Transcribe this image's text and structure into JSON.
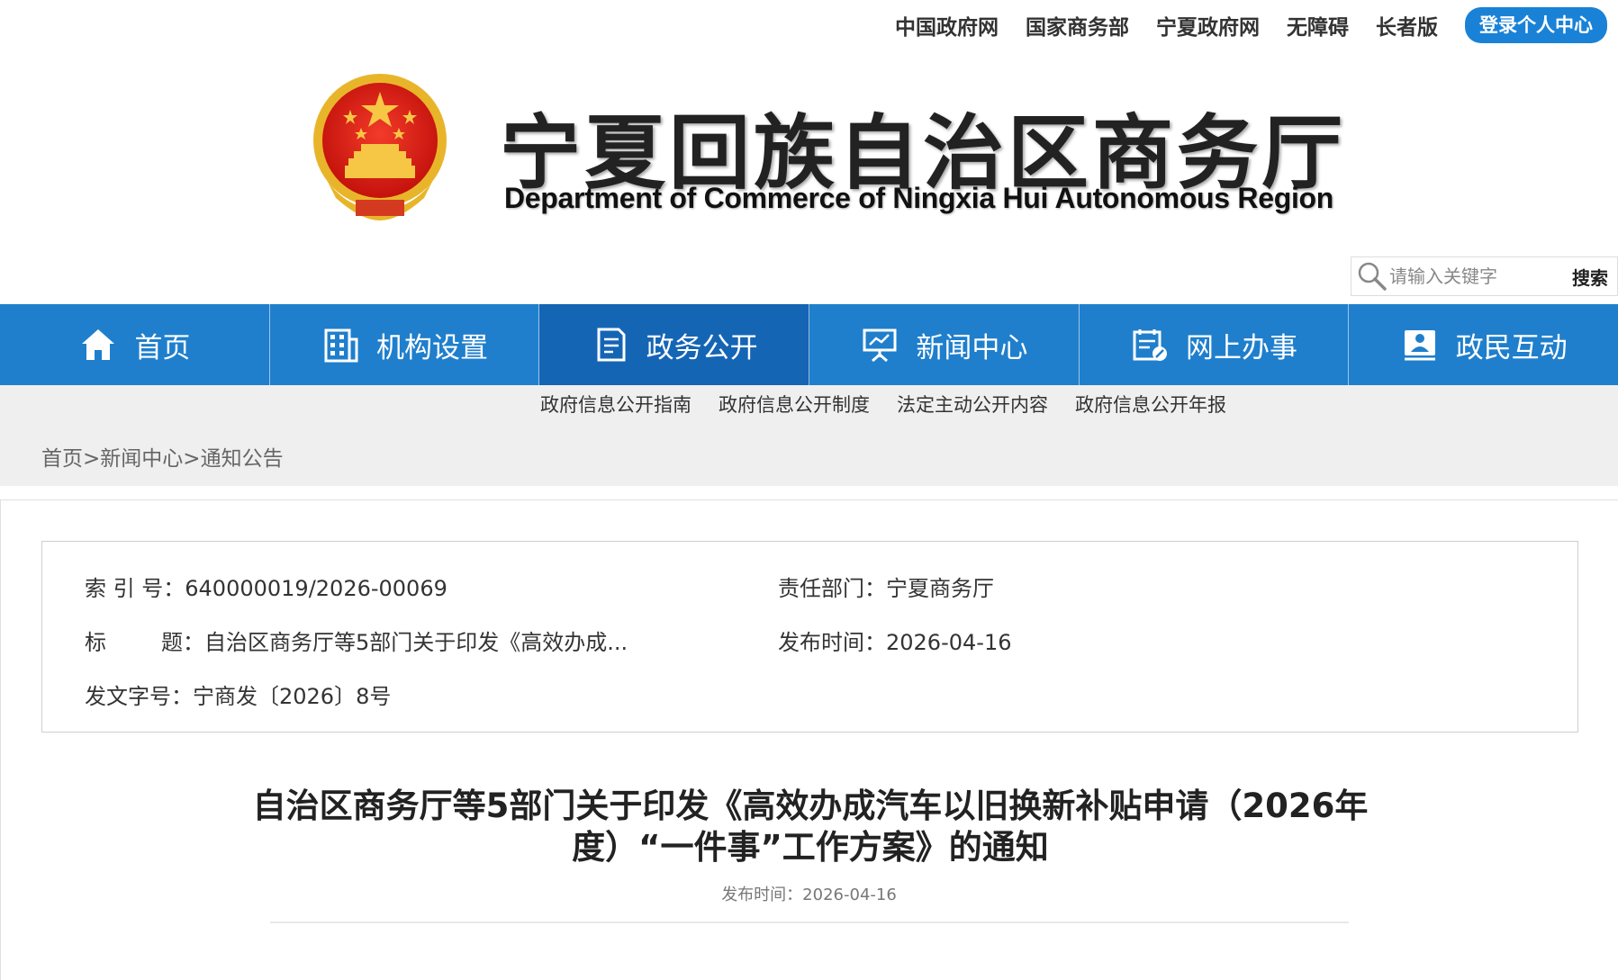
{
  "top_links": [
    "中国政府网",
    "国家商务部",
    "宁夏政府网",
    "无障碍",
    "长者版"
  ],
  "login_label": "登录个人中心",
  "header": {
    "title_cn": "宁夏回族自治区商务厅",
    "title_en": "Department of Commerce of Ningxia Hui Autonomous Region"
  },
  "search": {
    "placeholder": "请输入关键字",
    "button": "搜索"
  },
  "nav": [
    {
      "label": "首页",
      "icon": "home-icon"
    },
    {
      "label": "机构设置",
      "icon": "building-icon"
    },
    {
      "label": "政务公开",
      "icon": "document-icon",
      "active": true
    },
    {
      "label": "新闻中心",
      "icon": "presentation-icon"
    },
    {
      "label": "网上办事",
      "icon": "form-edit-icon"
    },
    {
      "label": "政民互动",
      "icon": "user-card-icon"
    }
  ],
  "subnav": [
    "政府信息公开指南",
    "政府信息公开制度",
    "法定主动公开内容",
    "政府信息公开年报"
  ],
  "breadcrumb": [
    "首页",
    "新闻中心",
    "通知公告"
  ],
  "meta": {
    "index_label": "索 引 号：",
    "index_value": "640000019/2026-00069",
    "dept_label": "责任部门：",
    "dept_value": "宁夏商务厅",
    "title_label": "标        题：",
    "title_value": "自治区商务厅等5部门关于印发《高效办成...",
    "date_label": "发布时间：",
    "date_value": "2026-04-16",
    "docno_label": "发文字号：",
    "docno_value": "宁商发〔2026〕8号"
  },
  "article": {
    "title": "自治区商务厅等5部门关于印发《高效办成汽车以旧换新补贴申请（2026年度）“一件事”工作方案》的通知",
    "pubtime": "发布时间：2026-04-16"
  },
  "colors": {
    "nav_blue": "#1f7fcc",
    "nav_active": "#1565b5",
    "login_blue": "#1a82d6"
  }
}
